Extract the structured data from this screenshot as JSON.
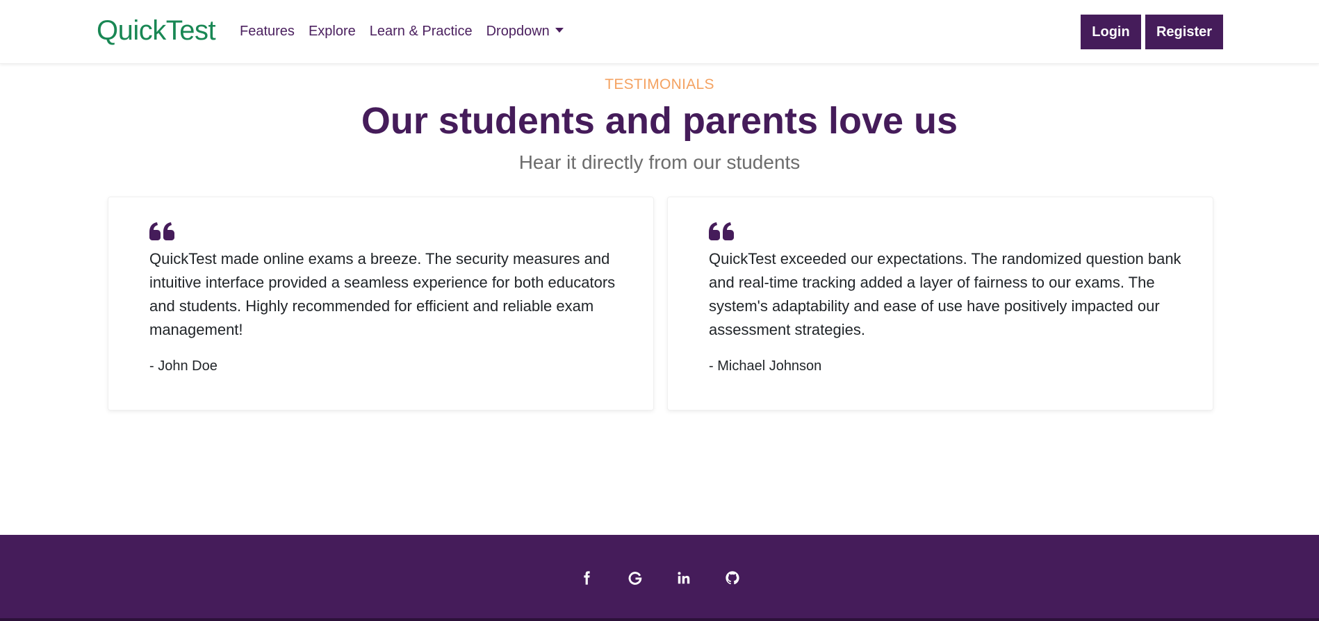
{
  "navbar": {
    "brand": "QuickTest",
    "links": [
      {
        "label": "Features"
      },
      {
        "label": "Explore"
      },
      {
        "label": "Learn & Practice"
      },
      {
        "label": "Dropdown"
      }
    ],
    "login_label": "Login",
    "register_label": "Register"
  },
  "testimonials": {
    "eyebrow": "TESTIMONIALS",
    "title": "Our students and parents love us",
    "subtitle": "Hear it directly from our students",
    "items": [
      {
        "quote": "QuickTest made online exams a breeze. The security measures and intuitive interface provided a seamless experience for both educators and students. Highly recommended for efficient and reliable exam management!",
        "author": "- John Doe"
      },
      {
        "quote": "QuickTest exceeded our expectations. The randomized question bank and real-time tracking added a layer of fairness to our exams. The system's adaptability and ease of use have positively impacted our assessment strategies.",
        "author": "- Michael Johnson"
      }
    ]
  },
  "footer": {
    "social_icons": [
      "facebook-icon",
      "google-icon",
      "linkedin-icon",
      "github-icon"
    ]
  },
  "colors": {
    "brand_green": "#198754",
    "primary_purple": "#451c5a",
    "accent_orange": "#f4a261",
    "muted_text": "#6c6c6c"
  }
}
